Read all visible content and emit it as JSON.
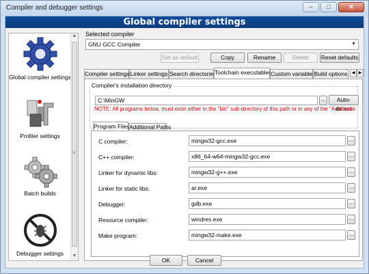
{
  "window": {
    "title": "Compiler and debugger settings",
    "controls": [
      "minimize",
      "maximize",
      "close"
    ]
  },
  "banner": "Global compiler settings",
  "left_panel": {
    "items": [
      {
        "label": "Global compiler settings",
        "icon": "gear-icon",
        "selected": true
      },
      {
        "label": "Profiler settings",
        "icon": "profiler-icon",
        "selected": false
      },
      {
        "label": "Batch builds",
        "icon": "batch-gears-icon",
        "selected": false
      },
      {
        "label": "Debugger settings",
        "icon": "debugger-bug-icon",
        "selected": false
      }
    ]
  },
  "selected_compiler": {
    "label": "Selected compiler",
    "value": "GNU GCC Compiler"
  },
  "compiler_buttons": {
    "set_default": "Set as default",
    "copy": "Copy",
    "rename": "Rename",
    "delete": "Delete",
    "reset_defaults": "Reset defaults"
  },
  "tabs": [
    "Compiler settings",
    "Linker settings",
    "Search directories",
    "Toolchain executables",
    "Custom variables",
    "Build options"
  ],
  "active_tab": "Toolchain executables",
  "install_dir": {
    "label": "Compiler's installation directory",
    "value": "C:\\MinGW",
    "browse": "...",
    "auto_detect": "Auto-detect",
    "note": "NOTE: All programs below, must exist either in the \"bin\" sub-directory of this path or in any of the \"Additional"
  },
  "sub_tabs": [
    "Program Files",
    "Additional Paths"
  ],
  "programs": [
    {
      "label": "C compiler:",
      "value": "mingw32-gcc.exe"
    },
    {
      "label": "C++ compiler:",
      "value": "x86_64-w64-mingw32-gcc.exe"
    },
    {
      "label": "Linker for dynamic libs:",
      "value": "mingw32-g++.exe"
    },
    {
      "label": "Linker for static libs:",
      "value": "ar.exe"
    },
    {
      "label": "Debugger:",
      "value": "gdb.exe"
    },
    {
      "label": "Resource compiler:",
      "value": "windres.exe"
    },
    {
      "label": "Make program:",
      "value": "mingw32-make.exe"
    }
  ],
  "browse_label": "...",
  "dialog_buttons": {
    "ok": "OK",
    "cancel": "Cancel"
  }
}
